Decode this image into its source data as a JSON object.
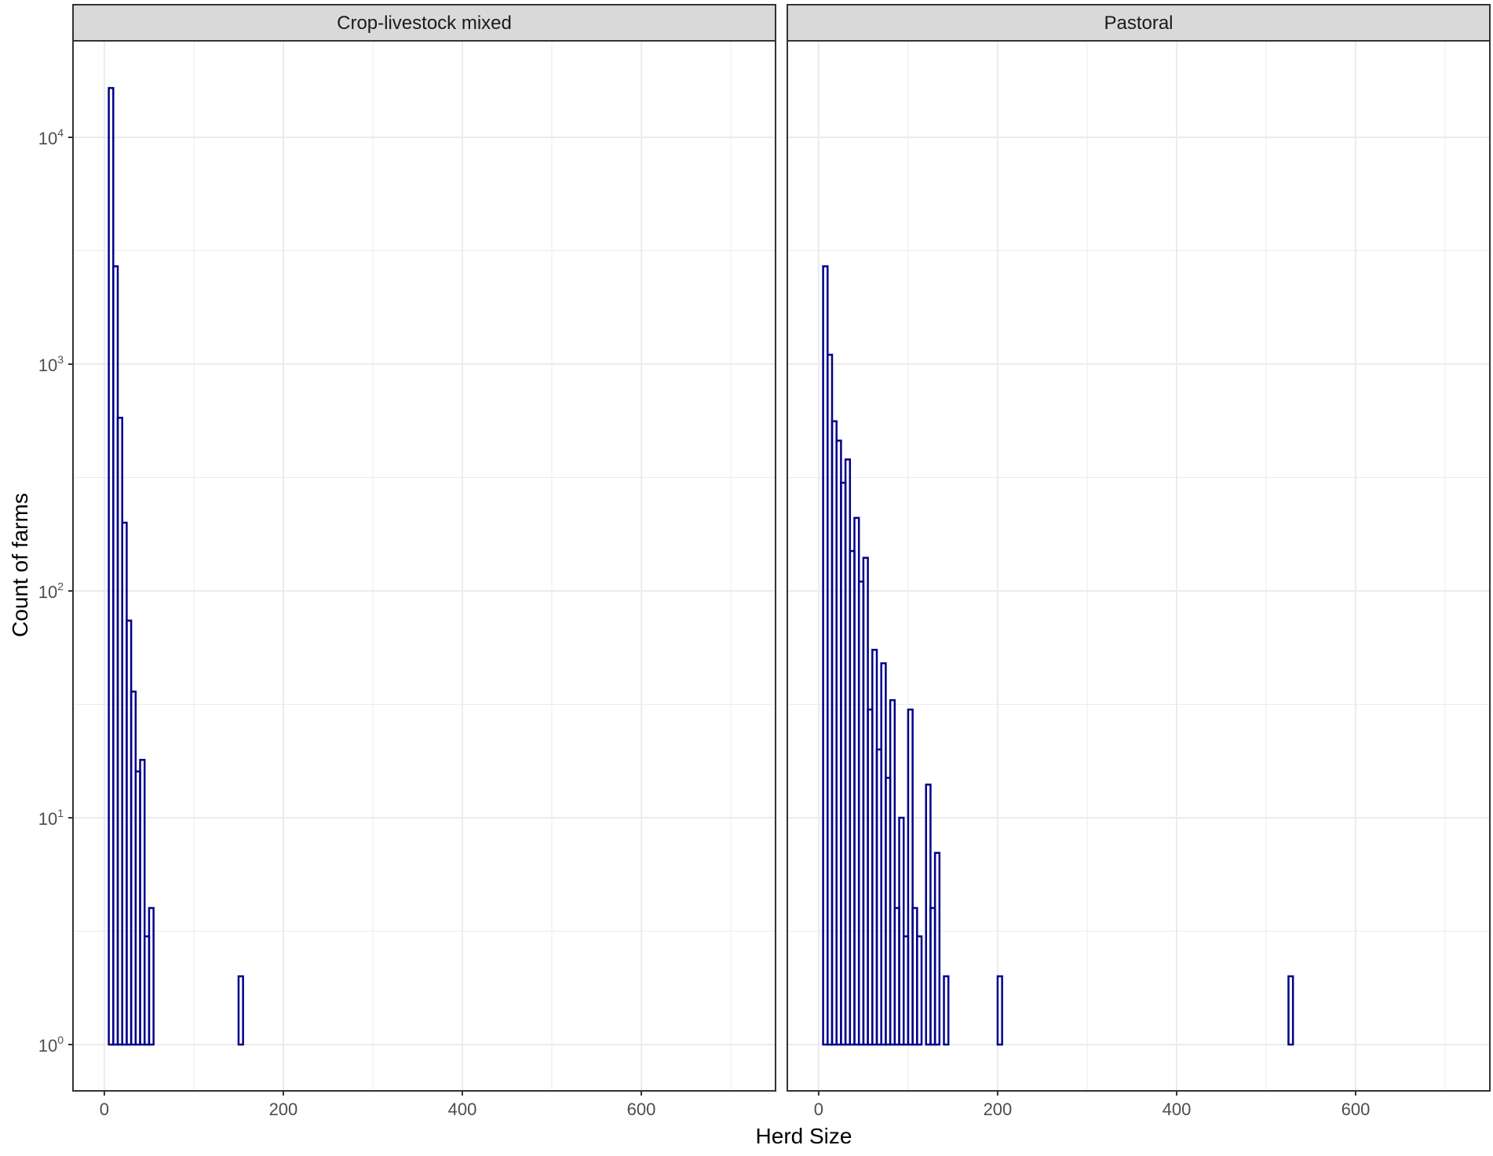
{
  "chart_data": {
    "type": "bar",
    "style": "faceted histogram, outlined bins, log10 y-axis, grid on",
    "xlabel": "Herd Size",
    "ylabel": "Count of farms",
    "x_ticks": [
      "0",
      "200",
      "400",
      "600"
    ],
    "x_tick_values": [
      0,
      200,
      400,
      600
    ],
    "xlim": [
      -35,
      750
    ],
    "y_scale": "log10",
    "y_ticks": [
      {
        "value": 1,
        "base": "10",
        "exp": "0"
      },
      {
        "value": 10,
        "base": "10",
        "exp": "1"
      },
      {
        "value": 100,
        "base": "10",
        "exp": "2"
      },
      {
        "value": 1000,
        "base": "10",
        "exp": "3"
      },
      {
        "value": 10000,
        "base": "10",
        "exp": "4"
      }
    ],
    "ylim": [
      0.8,
      25000
    ],
    "bar_color": "#00008B",
    "grid_color": "#ebebeb",
    "strip_color": "#d9d9d9",
    "facets": [
      {
        "name": "Crop-livestock mixed",
        "bins": [
          [
            5,
            10,
            16500
          ],
          [
            10,
            15,
            2700
          ],
          [
            15,
            20,
            580
          ],
          [
            20,
            25,
            200
          ],
          [
            25,
            30,
            74
          ],
          [
            30,
            35,
            36
          ],
          [
            35,
            40,
            16
          ],
          [
            40,
            45,
            18
          ],
          [
            45,
            50,
            3
          ],
          [
            50,
            55,
            4
          ],
          [
            65,
            70,
            1
          ],
          [
            85,
            90,
            1
          ],
          [
            110,
            115,
            1
          ],
          [
            150,
            155,
            2
          ]
        ]
      },
      {
        "name": "Pastoral",
        "bins": [
          [
            5,
            10,
            2700
          ],
          [
            10,
            15,
            1100
          ],
          [
            15,
            20,
            560
          ],
          [
            20,
            25,
            460
          ],
          [
            25,
            30,
            300
          ],
          [
            30,
            35,
            380
          ],
          [
            35,
            40,
            150
          ],
          [
            40,
            45,
            210
          ],
          [
            45,
            50,
            110
          ],
          [
            50,
            55,
            140
          ],
          [
            55,
            60,
            30
          ],
          [
            60,
            65,
            55
          ],
          [
            65,
            70,
            20
          ],
          [
            70,
            75,
            48
          ],
          [
            75,
            80,
            15
          ],
          [
            80,
            85,
            33
          ],
          [
            85,
            90,
            4
          ],
          [
            90,
            95,
            10
          ],
          [
            95,
            100,
            3
          ],
          [
            100,
            105,
            30
          ],
          [
            105,
            110,
            4
          ],
          [
            110,
            115,
            3
          ],
          [
            115,
            120,
            1
          ],
          [
            120,
            125,
            14
          ],
          [
            125,
            130,
            4
          ],
          [
            130,
            135,
            7
          ],
          [
            135,
            140,
            1
          ],
          [
            140,
            145,
            2
          ],
          [
            145,
            150,
            1
          ],
          [
            150,
            155,
            1
          ],
          [
            175,
            180,
            1
          ],
          [
            195,
            200,
            1
          ],
          [
            200,
            205,
            2
          ],
          [
            205,
            210,
            1
          ],
          [
            230,
            235,
            1
          ],
          [
            245,
            250,
            1
          ],
          [
            260,
            265,
            1
          ],
          [
            270,
            275,
            1
          ],
          [
            275,
            280,
            1
          ],
          [
            295,
            300,
            1
          ],
          [
            305,
            310,
            1
          ],
          [
            315,
            320,
            1
          ],
          [
            320,
            325,
            1
          ],
          [
            345,
            350,
            1
          ],
          [
            350,
            355,
            1
          ],
          [
            365,
            370,
            1
          ],
          [
            385,
            390,
            1
          ],
          [
            425,
            430,
            1
          ],
          [
            440,
            445,
            1
          ],
          [
            445,
            450,
            1
          ],
          [
            465,
            470,
            1
          ],
          [
            495,
            500,
            1
          ],
          [
            505,
            510,
            1
          ],
          [
            525,
            530,
            2
          ],
          [
            540,
            545,
            1
          ],
          [
            640,
            645,
            1
          ]
        ]
      }
    ]
  }
}
